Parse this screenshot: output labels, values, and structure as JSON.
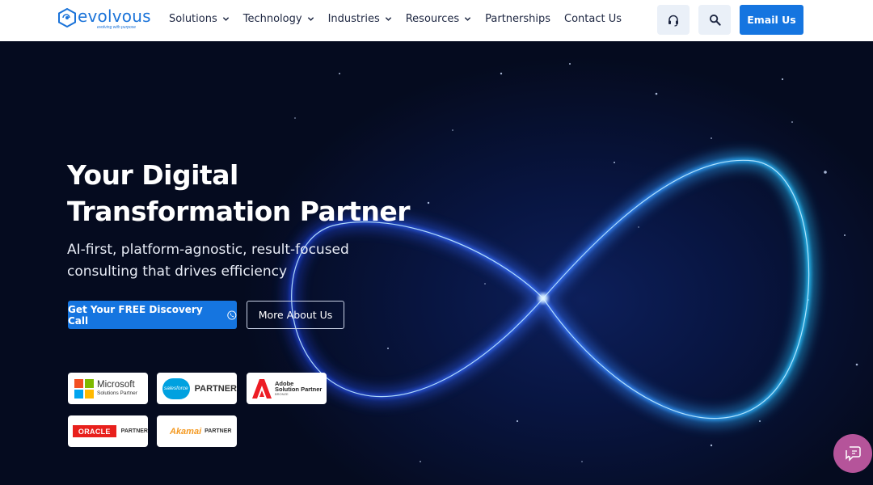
{
  "logo": {
    "wordmark": "evolvous",
    "tagline": "evolving with purpose"
  },
  "nav": {
    "items": [
      {
        "label": "Solutions",
        "has_dropdown": true
      },
      {
        "label": "Technology",
        "has_dropdown": true
      },
      {
        "label": "Industries",
        "has_dropdown": true
      },
      {
        "label": "Resources",
        "has_dropdown": true
      },
      {
        "label": "Partnerships",
        "has_dropdown": false
      },
      {
        "label": "Contact Us",
        "has_dropdown": false
      }
    ]
  },
  "header": {
    "support_icon": "headset-icon",
    "search_icon": "search-icon",
    "email_label": "Email Us"
  },
  "hero": {
    "title_line1": "Your Digital",
    "title_line2": "Transformation Partner",
    "subtitle_line1": "AI-first, platform-agnostic, result-focused",
    "subtitle_line2": "consulting that drives efficiency",
    "cta_primary": "Get Your FREE Discovery Call",
    "cta_secondary": "More About Us"
  },
  "badges": {
    "microsoft": {
      "name": "Microsoft",
      "sub": "Solutions Partner"
    },
    "salesforce": {
      "logo": "salesforce",
      "sub": "PARTNER"
    },
    "adobe": {
      "line1": "Adobe",
      "line2": "Solution Partner",
      "tier": "BRONZE"
    },
    "oracle": {
      "logo": "ORACLE",
      "sub": "PARTNER"
    },
    "akamai": {
      "logo": "Akamai",
      "sub": "PARTNER"
    }
  },
  "colors": {
    "brand": "#1a73d9",
    "primary_button": "#1575e0",
    "hero_bg": "#050b1f",
    "chat": "#b5549a"
  }
}
